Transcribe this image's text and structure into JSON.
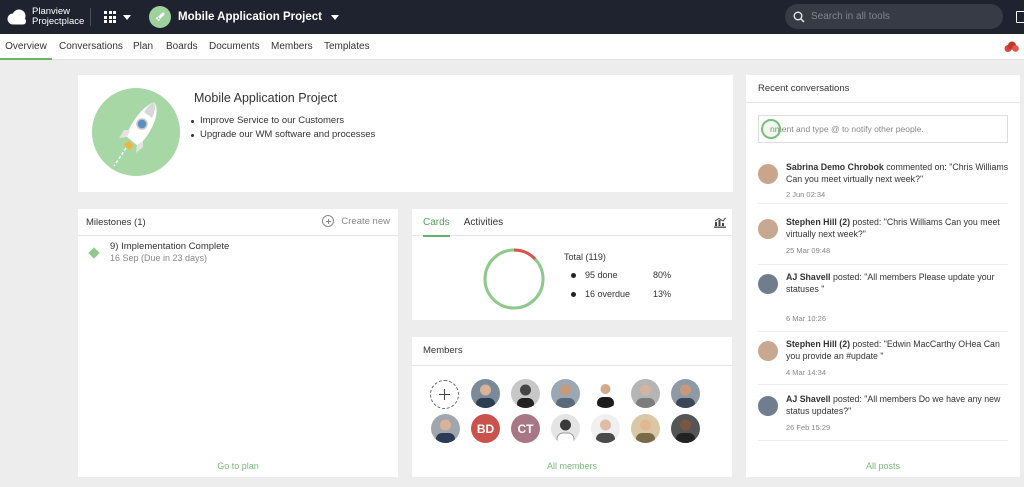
{
  "topbar": {
    "brand_line1": "Planview",
    "brand_line2": "Projectplace",
    "project_name": "Mobile Application Project",
    "search_placeholder": "Search in all tools"
  },
  "nav": {
    "tabs": [
      "Overview",
      "Conversations",
      "Plan",
      "Boards",
      "Documents",
      "Members",
      "Templates"
    ],
    "active": "Overview"
  },
  "hero": {
    "title": "Mobile Application Project",
    "bullets": [
      "Improve Service to our Customers",
      "Upgrade our WM software and processes"
    ]
  },
  "milestones": {
    "title": "Milestones (1)",
    "create_label": "Create new",
    "item_title": "9) Implementation Complete",
    "item_sub": "16 Sep (Due in 23 days)",
    "footer_link": "Go to plan"
  },
  "cards": {
    "tabs": [
      "Cards",
      "Activities"
    ],
    "total_label": "Total (119)",
    "done_label": "95 done",
    "done_pct": "80%",
    "overdue_label": "16 overdue",
    "overdue_pct": "13%",
    "done_fraction": 0.8,
    "overdue_fraction": 0.13,
    "colors": {
      "done": "#8cc98a",
      "overdue": "#d9534f",
      "track": "#e6e6e6"
    }
  },
  "members": {
    "title": "Members",
    "footer_link": "All members",
    "initials_bd": "BD",
    "initials_ct": "CT",
    "colors": {
      "bd": "#c9524d",
      "ct": "#a77785"
    }
  },
  "recent": {
    "title": "Recent conversations",
    "comment_placeholder": "nment and type @ to notify other people.",
    "footer_link": "All posts",
    "items": [
      {
        "author": "Sabrina Demo Chrobok",
        "action": " commented on: \"Chris Williams Can you meet virtually next week?\"",
        "time": "2 Jun 02:34"
      },
      {
        "author": "Stephen Hill (2)",
        "action": " posted: \"Chris Williams Can you meet virtually next week?\"",
        "time": "25 Mar 09:48"
      },
      {
        "author": "AJ Shavell",
        "action": " posted: \"All members Please update your statuses \"",
        "time": "6 Mar 10:26"
      },
      {
        "author": "Stephen Hill (2)",
        "action": " posted: \"Edwin MacCarthy OHea Can you provide an #update \"",
        "time": "4 Mar 14:34"
      },
      {
        "author": "AJ Shavell",
        "action": " posted: \"All members Do we have any new status updates?\"",
        "time": "26 Feb 15:29"
      }
    ]
  },
  "icons": [
    "cloud-logo-icon",
    "apps-grid-icon",
    "rocket-icon",
    "search-icon",
    "chart-icon",
    "plus-icon",
    "milestone-diamond-icon"
  ]
}
